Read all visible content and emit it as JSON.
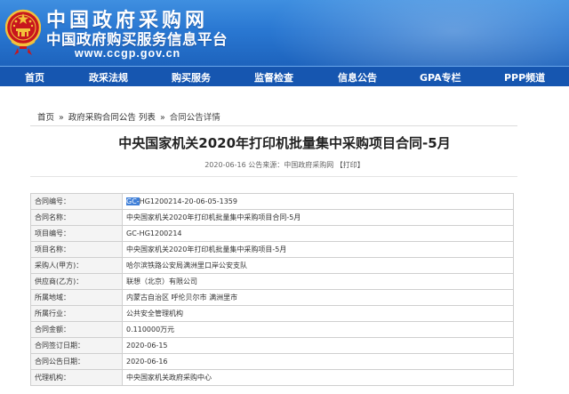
{
  "header": {
    "site_name": "中国政府采购网",
    "site_subtitle": "中国政府购买服务信息平台",
    "site_url": "www.ccgp.gov.cn"
  },
  "nav": [
    {
      "label": "首页"
    },
    {
      "label": "政采法规"
    },
    {
      "label": "购买服务"
    },
    {
      "label": "监督检查"
    },
    {
      "label": "信息公告"
    },
    {
      "label": "GPA专栏"
    },
    {
      "label": "PPP频道"
    }
  ],
  "breadcrumb": [
    {
      "label": "首页"
    },
    {
      "label": "政府采购合同公告 列表"
    },
    {
      "label": "合同公告详情"
    }
  ],
  "breadcrumb_sep": "»",
  "article": {
    "title": "中央国家机关2020年打印机批量集中采购项目合同-5月",
    "meta": "2020-06-16 公告来源：中国政府采购网",
    "print_label": "【打印】"
  },
  "contract": {
    "rows": [
      {
        "key": "合同编号：",
        "value_prefix": "GC-",
        "value": "HG1200214-20-06-05-1359"
      },
      {
        "key": "合同名称：",
        "value": "中央国家机关2020年打印机批量集中采购项目合同-5月"
      },
      {
        "key": "项目编号：",
        "value": "GC-HG1200214"
      },
      {
        "key": "项目名称：",
        "value": "中央国家机关2020年打印机批量集中采购项目-5月"
      },
      {
        "key": "采购人(甲方)：",
        "value": "哈尔滨铁路公安局满洲里口岸公安支队"
      },
      {
        "key": "供应商(乙方)：",
        "value": "联想（北京）有限公司"
      },
      {
        "key": "所属地域：",
        "value": "内蒙古自治区 呼伦贝尔市 满洲里市"
      },
      {
        "key": "所属行业：",
        "value": "公共安全管理机构"
      },
      {
        "key": "合同金额：",
        "value": "0.110000万元"
      },
      {
        "key": "合同签订日期：",
        "value": "2020-06-15"
      },
      {
        "key": "合同公告日期：",
        "value": "2020-06-16"
      },
      {
        "key": "代理机构：",
        "value": "中央国家机关政府采购中心"
      }
    ]
  },
  "colors": {
    "banner_top": "#3f8fe0",
    "banner_bottom": "#1d63bd",
    "nav_bg": "#1656b0",
    "selection": "#3f7fd8"
  },
  "icons": {
    "emblem": "national-emblem-icon"
  }
}
